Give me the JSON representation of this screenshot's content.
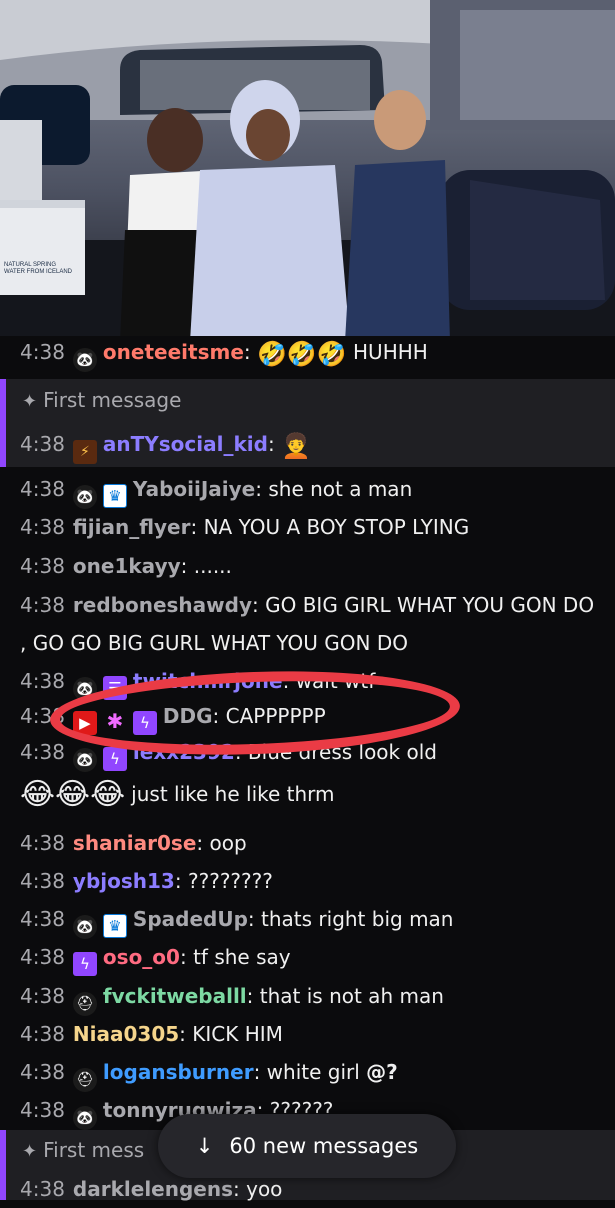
{
  "stream": {
    "water_box_text": "NATURAL SPRING WATER FROM ICELAND"
  },
  "colors": {
    "accent": "#9146ff",
    "annotation": "#ea3b45"
  },
  "chat": {
    "messages": [
      {
        "time": "4:38",
        "name": "oneteeitsme",
        "color": "#ff7a6b",
        "text": "",
        "emotes": "🤣🤣🤣",
        "after": " HUHHH"
      },
      {
        "time": "4:38",
        "name": "anTYsocial_kid",
        "color": "#8c7dff",
        "text": "",
        "emotes": "🧑‍🦱"
      },
      {
        "time": "4:38",
        "name": "YaboiiJaiye",
        "color": "#a9a9ae",
        "text": "she not a man"
      },
      {
        "time": "4:38",
        "name": "fijian_flyer",
        "color": "#a9a9ae",
        "text": "NA YOU A BOY STOP LYING"
      },
      {
        "time": "4:38",
        "name": "one1kayy",
        "color": "#a9a9ae",
        "text": "......"
      },
      {
        "time": "4:38",
        "name": "redboneshawdy",
        "color": "#a9a9ae",
        "text": "GO BIG GIRL WHAT YOU GON DO , GO GO BIG GURL WHAT YOU GON DO"
      },
      {
        "time": "4:38",
        "name": "twitchmrjone",
        "color": "#8c7dff",
        "text": "wait wtf"
      },
      {
        "time": "4:38",
        "name": "DDG",
        "color": "#a9a9ae",
        "text": "CAPPPPPP"
      },
      {
        "time": "4:38",
        "name": "lexx2392",
        "color": "#8c7dff",
        "text": "Blue dress look old"
      },
      {
        "time": "",
        "name": "",
        "color": "#ffffff",
        "text": "just like he like thrm",
        "emotes": "😂😂😂"
      },
      {
        "time": "4:38",
        "name": "shaniar0se",
        "color": "#ff8a80",
        "text": "oop"
      },
      {
        "time": "4:38",
        "name": "ybjosh13",
        "color": "#8c7dff",
        "text": "????????"
      },
      {
        "time": "4:38",
        "name": "SpadedUp",
        "color": "#a9a9ae",
        "text": "thats right big man"
      },
      {
        "time": "4:38",
        "name": "oso_o0",
        "color": "#ff6b81",
        "text": "tf she say"
      },
      {
        "time": "4:38",
        "name": "fvckitweballl",
        "color": "#7dd9a3",
        "text": "that is not ah man"
      },
      {
        "time": "4:38",
        "name": "Niaa0305",
        "color": "#f5d58c",
        "text": "KICK HIM"
      },
      {
        "time": "4:38",
        "name": "logansburner",
        "color": "#3f9cff",
        "text": "white girl ",
        "bold_tail": "@?"
      },
      {
        "time": "4:38",
        "name": "tonnyrugwiza",
        "color": "#a9a9ae",
        "text": "??????"
      },
      {
        "time": "4:38",
        "name": "darklelengens",
        "color": "#a9a9ae",
        "text": "yoo"
      }
    ],
    "first_message_label": "First message",
    "first_message_label_2": "First mess",
    "new_messages_pill": "60 new messages"
  }
}
